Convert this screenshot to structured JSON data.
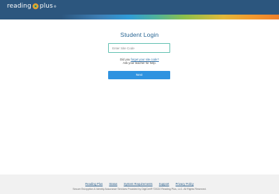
{
  "header": {
    "logo_text_left": "reading",
    "logo_text_right": "plus",
    "logo_trademark": "®"
  },
  "login": {
    "title": "Student Login",
    "site_code_placeholder": "Enter Site Code",
    "site_code_value": "",
    "help_prefix": "Did you ",
    "help_link": "forget your site code?",
    "help_suffix": "Ask your teacher for help.",
    "next_label": "Next"
  },
  "footer": {
    "links": [
      "Reading Plus",
      "Status",
      "System Requirements",
      "Support",
      "Privacy Policy"
    ],
    "copyright": "Secure Encryption & Identity Assurance Services Provided by DigiCert® ©2022 Reading Plus, LLC. All Rights Reserved."
  },
  "colors": {
    "header_bg": "#2c567e",
    "title": "#1f5f8f",
    "input_border": "#5fbfb0",
    "button_bg": "#2f93e0",
    "link": "#2f6fa8"
  }
}
